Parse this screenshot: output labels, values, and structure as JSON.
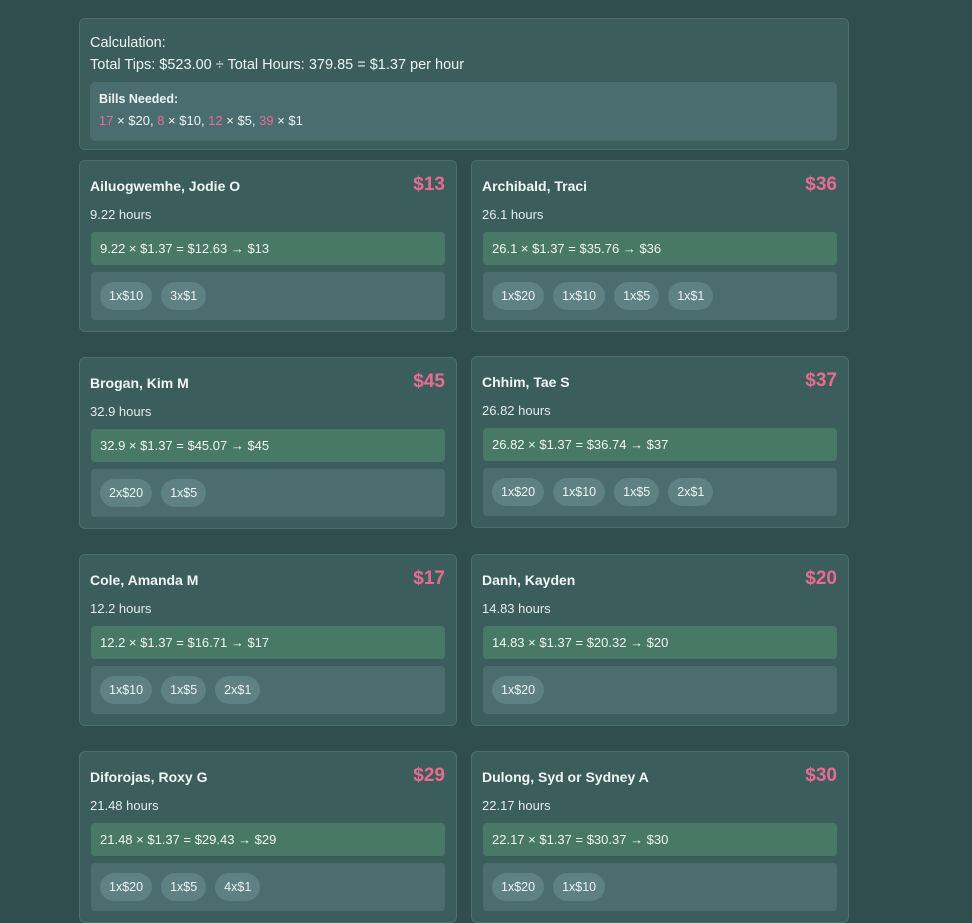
{
  "summary": {
    "calc_label": "Calculation:",
    "calc_line": "Total Tips: $523.00 ÷ Total Hours: 379.85 = $1.37 per hour",
    "bills_heading": "Bills Needed:",
    "bills": [
      {
        "count": "17",
        "denom": " × $20, "
      },
      {
        "count": "8",
        "denom": " × $10, "
      },
      {
        "count": "12",
        "denom": " × $5, "
      },
      {
        "count": "39",
        "denom": " × $1"
      }
    ]
  },
  "employees": [
    {
      "name": "Ailuogwemhe, Jodie O",
      "amount": "$13",
      "hours": "9.22 hours",
      "calc": "9.22 × $1.37 = $12.63 → $13",
      "bills": [
        "1x$10",
        "3x$1"
      ]
    },
    {
      "name": "Archibald, Traci",
      "amount": "$36",
      "hours": "26.1 hours",
      "calc": "26.1 × $1.37 = $35.76 → $36",
      "bills": [
        "1x$20",
        "1x$10",
        "1x$5",
        "1x$1"
      ]
    },
    {
      "name": "Brogan, Kim M",
      "amount": "$45",
      "hours": "32.9 hours",
      "calc": "32.9 × $1.37 = $45.07 → $45",
      "bills": [
        "2x$20",
        "1x$5"
      ]
    },
    {
      "name": "Chhim, Tae S",
      "amount": "$37",
      "hours": "26.82 hours",
      "calc": "26.82 × $1.37 = $36.74 → $37",
      "bills": [
        "1x$20",
        "1x$10",
        "1x$5",
        "2x$1"
      ]
    },
    {
      "name": "Cole, Amanda M",
      "amount": "$17",
      "hours": "12.2 hours",
      "calc": "12.2 × $1.37 = $16.71 → $17",
      "bills": [
        "1x$10",
        "1x$5",
        "2x$1"
      ]
    },
    {
      "name": "Danh, Kayden",
      "amount": "$20",
      "hours": "14.83 hours",
      "calc": "14.83 × $1.37 = $20.32 → $20",
      "bills": [
        "1x$20"
      ]
    },
    {
      "name": "Diforojas, Roxy G",
      "amount": "$29",
      "hours": "21.48 hours",
      "calc": "21.48 × $1.37 = $29.43 → $29",
      "bills": [
        "1x$20",
        "1x$5",
        "4x$1"
      ]
    },
    {
      "name": "Dulong, Syd or Sydney A",
      "amount": "$30",
      "hours": "22.17 hours",
      "calc": "22.17 × $1.37 = $30.37 → $30",
      "bills": [
        "1x$20",
        "1x$10"
      ]
    }
  ]
}
